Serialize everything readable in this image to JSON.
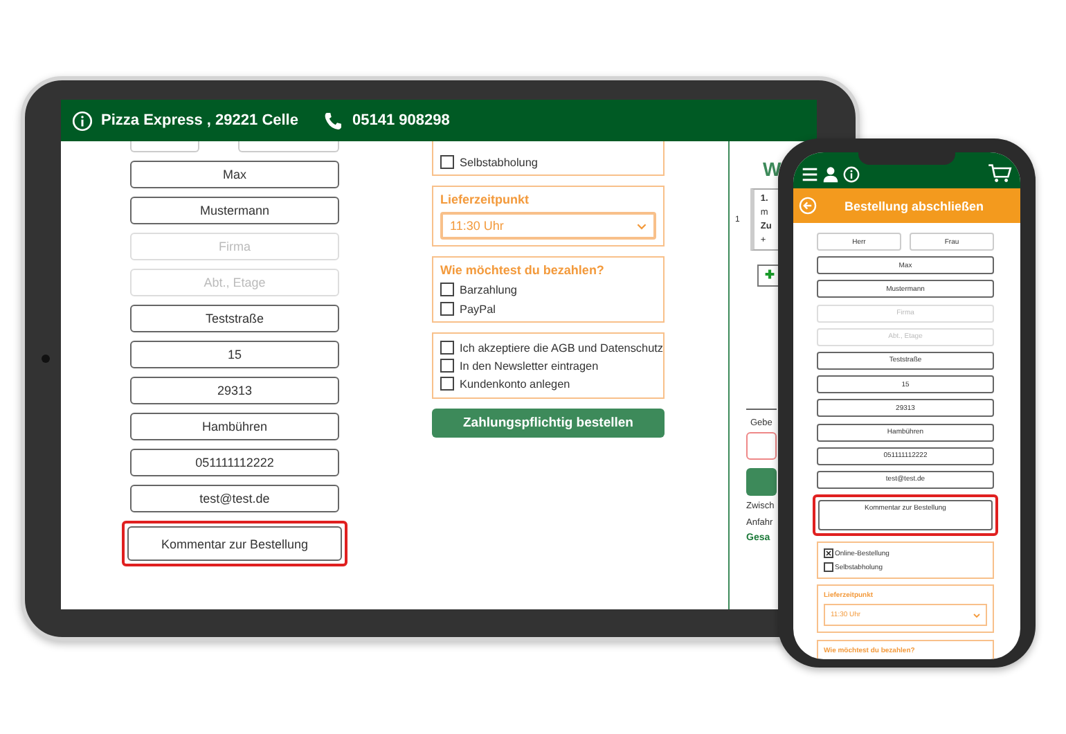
{
  "tablet": {
    "header": {
      "shop": "Pizza Express , 29221 Celle",
      "phone": "05141 908298"
    },
    "fields": [
      {
        "kind": "input",
        "value": "Max"
      },
      {
        "kind": "input",
        "value": "Mustermann"
      },
      {
        "kind": "input",
        "placeholder": "Firma"
      },
      {
        "kind": "input",
        "placeholder": "Abt., Etage"
      },
      {
        "kind": "input",
        "value": "Teststraße"
      },
      {
        "kind": "input",
        "value": "15"
      },
      {
        "kind": "input",
        "value": "29313"
      },
      {
        "kind": "input",
        "value": "Hambühren"
      },
      {
        "kind": "input",
        "value": "051111112222"
      },
      {
        "kind": "input",
        "value": "test@test.de"
      },
      {
        "kind": "textarea",
        "value": "Kommentar zur Bestellung",
        "highlighted": true
      }
    ],
    "delivery_options": [
      {
        "label": "Selbstabholung",
        "checked": false
      }
    ],
    "delivery_time": {
      "label": "Lieferzeitpunkt",
      "value": "11:30 Uhr"
    },
    "payment": {
      "title": "Wie möchtest du bezahlen?",
      "options": [
        {
          "label": "Barzahlung",
          "checked": false
        },
        {
          "label": "PayPal",
          "checked": false
        }
      ]
    },
    "agreements": [
      {
        "label": "Ich akzeptiere die AGB und Datenschutz",
        "checked": false
      },
      {
        "label": "In den Newsletter eintragen",
        "checked": false
      },
      {
        "label": "Kundenkonto anlegen",
        "checked": false
      }
    ],
    "order_button": "Zahlungspflichtig bestellen",
    "summary": {
      "heading": "W",
      "item_qty": "1",
      "item_lines": [
        {
          "text": "1.",
          "bold": true
        },
        {
          "text": "m",
          "bold": false
        },
        {
          "text": "Zu",
          "bold": true
        },
        {
          "text": "+",
          "bold": false
        }
      ],
      "voucher_label": "Gebe",
      "subtotal": "Zwisch",
      "delivery": "Anfahr",
      "total": "Gesa"
    }
  },
  "phone": {
    "title": "Bestellung abschließen",
    "salutations": [
      "Herr",
      "Frau"
    ],
    "fields": [
      {
        "kind": "input",
        "value": "Max"
      },
      {
        "kind": "input",
        "value": "Mustermann"
      },
      {
        "kind": "input",
        "placeholder": "Firma"
      },
      {
        "kind": "input",
        "placeholder": "Abt., Etage"
      },
      {
        "kind": "input",
        "value": "Teststraße"
      },
      {
        "kind": "input",
        "value": "15"
      },
      {
        "kind": "input",
        "value": "29313"
      },
      {
        "kind": "input",
        "value": "Hambühren"
      },
      {
        "kind": "input",
        "value": "051111112222"
      },
      {
        "kind": "input",
        "value": "test@test.de"
      },
      {
        "kind": "textarea",
        "value": "Kommentar zur Bestellung",
        "highlighted": true
      }
    ],
    "delivery_options": [
      {
        "label": "Online-Bestellung",
        "checked": true
      },
      {
        "label": "Selbstabholung",
        "checked": false
      }
    ],
    "delivery_time": {
      "label": "Lieferzeitpunkt",
      "value": "11:30 Uhr"
    },
    "payment_title": "Wie möchtest du bezahlen?"
  }
}
